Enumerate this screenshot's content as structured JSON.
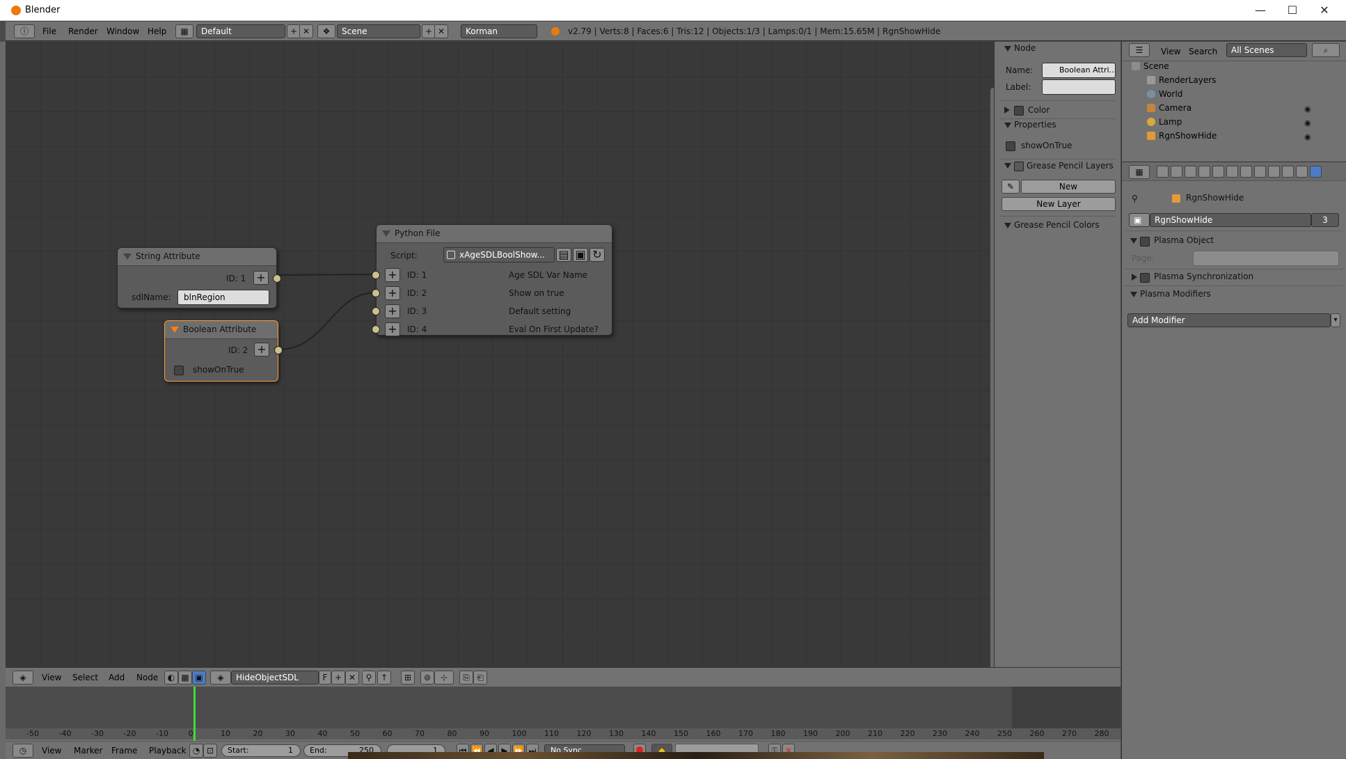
{
  "window": {
    "title": "Blender",
    "minimize": "—",
    "maximize": "☐",
    "close": "✕"
  },
  "menubar": {
    "menus": [
      "File",
      "Render",
      "Window",
      "Help"
    ],
    "layout": "Default",
    "scene": "Scene",
    "engine": "Korman",
    "stats": "v2.79 | Verts:8 | Faces:6 | Tris:12 | Objects:1/3 | Lamps:0/1 | Mem:15.65M | RgnShowHide"
  },
  "nodes": {
    "string_attribute": {
      "title": "String Attribute",
      "id_label": "ID: 1",
      "sdl_label": "sdlName:",
      "sdl_value": "blnRegion"
    },
    "boolean_attribute": {
      "title": "Boolean Attribute",
      "id_label": "ID: 2",
      "checkbox_label": "showOnTrue"
    },
    "python_file": {
      "title": "Python File",
      "script_label": "Script:",
      "script_value": "xAgeSDLBoolShow...",
      "params": [
        {
          "id": "ID: 1",
          "desc": "Age SDL Var Name"
        },
        {
          "id": "ID: 2",
          "desc": "Show on true"
        },
        {
          "id": "ID: 3",
          "desc": "Default setting"
        },
        {
          "id": "ID: 4",
          "desc": "Eval On First Update?"
        }
      ]
    }
  },
  "node_sidebar": {
    "node_section": "Node",
    "name_label": "Name:",
    "name_value": "Boolean Attri...",
    "label_label": "Label:",
    "color_section": "Color",
    "properties_section": "Properties",
    "show_on_true": "showOnTrue",
    "gp_layers_section": "Grease Pencil Layers",
    "new_button": "New",
    "new_layer_button": "New Layer",
    "gp_colors_section": "Grease Pencil Colors"
  },
  "node_editor_header": {
    "menus": [
      "View",
      "Select",
      "Add",
      "Node"
    ],
    "tree_name": "HideObjectSDL",
    "fake_user": "F"
  },
  "outliner": {
    "view": "View",
    "search": "Search",
    "filter": "All Scenes",
    "items": [
      "Scene",
      "RenderLayers",
      "World",
      "Camera",
      "Lamp",
      "RgnShowHide"
    ],
    "colors": {
      "scene": "#8d8d8d",
      "renderlayers": "#9a9a9a",
      "world": "#7c8fa0",
      "camera": "#c0863a",
      "lamp": "#d9a83c",
      "object": "#e29a3b"
    }
  },
  "properties": {
    "object_crumb": "RgnShowHide",
    "object_name": "RgnShowHide",
    "users": "3",
    "plasma_object": "Plasma Object",
    "page_label": "Page:",
    "plasma_sync": "Plasma Synchronization",
    "plasma_modifiers": "Plasma Modifiers",
    "add_modifier": "Add Modifier"
  },
  "timeline": {
    "menus": [
      "View",
      "Marker",
      "Frame",
      "Playback"
    ],
    "start_label": "Start:",
    "start": "1",
    "end_label": "End:",
    "end": "250",
    "current": "1",
    "sync": "No Sync",
    "ruler": [
      "-50",
      "-40",
      "-30",
      "-20",
      "-10",
      "0",
      "10",
      "20",
      "30",
      "40",
      "50",
      "60",
      "70",
      "80",
      "90",
      "100",
      "110",
      "120",
      "130",
      "140",
      "150",
      "160",
      "170",
      "180",
      "190",
      "200",
      "210",
      "220",
      "230",
      "240",
      "250",
      "260",
      "270",
      "280"
    ],
    "current_frame_value": 0
  }
}
